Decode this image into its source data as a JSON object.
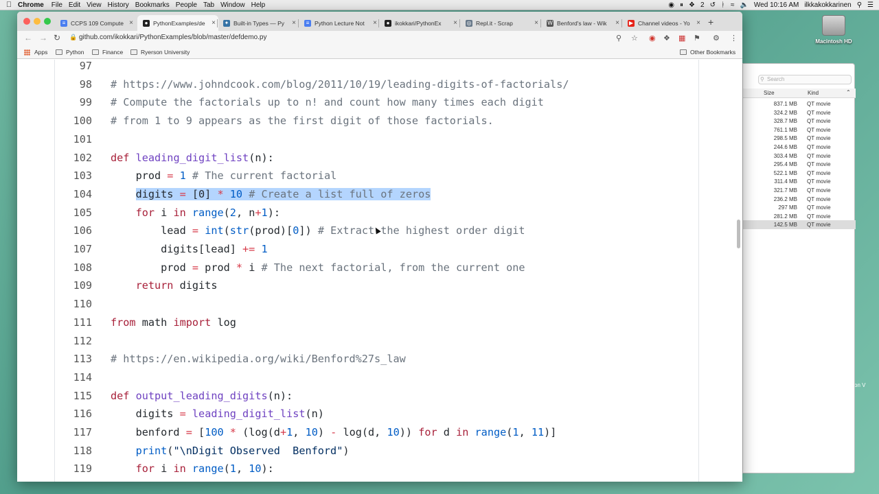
{
  "menubar": {
    "app": "Chrome",
    "items": [
      "File",
      "Edit",
      "View",
      "History",
      "Bookmarks",
      "People",
      "Tab",
      "Window",
      "Help"
    ],
    "status": {
      "badge": "2",
      "datetime": "Wed 10:16 AM",
      "user": "ilkkakokkarinen"
    }
  },
  "desktop": {
    "drive_label": "Macintosh HD",
    "fragment": "on V"
  },
  "finder": {
    "search_placeholder": "Search",
    "columns": {
      "size": "Size",
      "kind": "Kind"
    },
    "rows": [
      {
        "size": "837.1 MB",
        "kind": "QT movie"
      },
      {
        "size": "324.2 MB",
        "kind": "QT movie"
      },
      {
        "size": "328.7 MB",
        "kind": "QT movie"
      },
      {
        "size": "761.1 MB",
        "kind": "QT movie"
      },
      {
        "size": "298.5 MB",
        "kind": "QT movie"
      },
      {
        "size": "244.6 MB",
        "kind": "QT movie"
      },
      {
        "size": "303.4 MB",
        "kind": "QT movie"
      },
      {
        "size": "295.4 MB",
        "kind": "QT movie"
      },
      {
        "size": "522.1 MB",
        "kind": "QT movie"
      },
      {
        "size": "311.4 MB",
        "kind": "QT movie"
      },
      {
        "size": "321.7 MB",
        "kind": "QT movie"
      },
      {
        "size": "236.2 MB",
        "kind": "QT movie"
      },
      {
        "size": "297 MB",
        "kind": "QT movie"
      },
      {
        "size": "281.2 MB",
        "kind": "QT movie"
      },
      {
        "size": "142.5 MB",
        "kind": "QT movie"
      }
    ]
  },
  "browser": {
    "tabs": [
      {
        "title": "CCPS 109 Compute",
        "icon": "docs-icon",
        "color": "#4a7ef0"
      },
      {
        "title": "PythonExamples/de",
        "icon": "github-icon",
        "color": "#222222"
      },
      {
        "title": "Built-in Types — Py",
        "icon": "python-icon",
        "color": "#3572a5"
      },
      {
        "title": "Python Lecture Not",
        "icon": "docs-icon",
        "color": "#4a7ef0"
      },
      {
        "title": "ikokkari/PythonEx",
        "icon": "github-icon",
        "color": "#222222"
      },
      {
        "title": "Repl.it - Scrap",
        "icon": "replit-icon",
        "color": "#667788"
      },
      {
        "title": "Benford's law - Wik",
        "icon": "wikipedia-icon",
        "color": "#555555"
      },
      {
        "title": "Channel videos - Yo",
        "icon": "youtube-icon",
        "color": "#e62117"
      }
    ],
    "url": "github.com/ikokkari/PythonExamples/blob/master/defdemo.py",
    "bookmarks": [
      "Apps",
      "Python",
      "Finance",
      "Ryerson University"
    ],
    "other_bookmarks": "Other Bookmarks"
  },
  "code": {
    "lines": [
      {
        "n": "97",
        "t": []
      },
      {
        "n": "98",
        "t": [
          [
            "cm",
            "# https://www.johndcook.com/blog/2011/10/19/leading-digits-of-factorials/"
          ]
        ]
      },
      {
        "n": "99",
        "t": [
          [
            "cm",
            "# Compute the factorials up to n! and count how many times each digit"
          ]
        ]
      },
      {
        "n": "100",
        "t": [
          [
            "cm",
            "# from 1 to 9 appears as the first digit of those factorials."
          ]
        ]
      },
      {
        "n": "101",
        "t": []
      },
      {
        "n": "102",
        "t": [
          [
            "kw",
            "def"
          ],
          [
            "",
            " "
          ],
          [
            "fn",
            "leading_digit_list"
          ],
          [
            "",
            "(n):"
          ]
        ]
      },
      {
        "n": "103",
        "t": [
          [
            "",
            "    prod "
          ],
          [
            "op",
            "="
          ],
          [
            "",
            " "
          ],
          [
            "nu",
            "1"
          ],
          [
            "",
            " "
          ],
          [
            "cm",
            "# The current factorial"
          ]
        ]
      },
      {
        "n": "104",
        "hl": true,
        "t": [
          [
            "",
            "    "
          ],
          [
            "hl",
            "digits "
          ],
          [
            "hl op",
            "="
          ],
          [
            "hl",
            " [0] "
          ],
          [
            "hl op",
            "*"
          ],
          [
            "hl",
            " "
          ],
          [
            "hl nu",
            "10"
          ],
          [
            "hl",
            " "
          ],
          [
            "hl cm",
            "# Create a list full of zeros"
          ]
        ]
      },
      {
        "n": "105",
        "t": [
          [
            "",
            "    "
          ],
          [
            "kw",
            "for"
          ],
          [
            "",
            " i "
          ],
          [
            "kw",
            "in"
          ],
          [
            "",
            " "
          ],
          [
            "bi",
            "range"
          ],
          [
            "",
            "("
          ],
          [
            "nu",
            "2"
          ],
          [
            "",
            ", n"
          ],
          [
            "op",
            "+"
          ],
          [
            "nu",
            "1"
          ],
          [
            "",
            "):"
          ]
        ]
      },
      {
        "n": "106",
        "t": [
          [
            "",
            "        lead "
          ],
          [
            "op",
            "="
          ],
          [
            "",
            " "
          ],
          [
            "bi",
            "int"
          ],
          [
            "",
            "("
          ],
          [
            "bi",
            "str"
          ],
          [
            "",
            "(prod)["
          ],
          [
            "nu",
            "0"
          ],
          [
            "",
            "]) "
          ],
          [
            "cm",
            "# Extract the highest order digit"
          ]
        ]
      },
      {
        "n": "107",
        "t": [
          [
            "",
            "        digits[lead] "
          ],
          [
            "op",
            "+="
          ],
          [
            "",
            " "
          ],
          [
            "nu",
            "1"
          ]
        ]
      },
      {
        "n": "108",
        "t": [
          [
            "",
            "        prod "
          ],
          [
            "op",
            "="
          ],
          [
            "",
            " prod "
          ],
          [
            "op",
            "*"
          ],
          [
            "",
            " i "
          ],
          [
            "cm",
            "# The next factorial, from the current one"
          ]
        ]
      },
      {
        "n": "109",
        "t": [
          [
            "",
            "    "
          ],
          [
            "kw",
            "return"
          ],
          [
            "",
            " digits"
          ]
        ]
      },
      {
        "n": "110",
        "t": []
      },
      {
        "n": "111",
        "t": [
          [
            "kw",
            "from"
          ],
          [
            "",
            " math "
          ],
          [
            "kw",
            "import"
          ],
          [
            "",
            " log"
          ]
        ]
      },
      {
        "n": "112",
        "t": []
      },
      {
        "n": "113",
        "t": [
          [
            "cm",
            "# https://en.wikipedia.org/wiki/Benford%27s_law"
          ]
        ]
      },
      {
        "n": "114",
        "t": []
      },
      {
        "n": "115",
        "t": [
          [
            "kw",
            "def"
          ],
          [
            "",
            " "
          ],
          [
            "fn",
            "output_leading_digits"
          ],
          [
            "",
            "(n):"
          ]
        ]
      },
      {
        "n": "116",
        "t": [
          [
            "",
            "    digits "
          ],
          [
            "op",
            "="
          ],
          [
            "",
            " "
          ],
          [
            "fn",
            "leading_digit_list"
          ],
          [
            "",
            "(n)"
          ]
        ]
      },
      {
        "n": "117",
        "t": [
          [
            "",
            "    benford "
          ],
          [
            "op",
            "="
          ],
          [
            "",
            " ["
          ],
          [
            "nu",
            "100"
          ],
          [
            "",
            " "
          ],
          [
            "op",
            "*"
          ],
          [
            "",
            " (log(d"
          ],
          [
            "op",
            "+"
          ],
          [
            "nu",
            "1"
          ],
          [
            "",
            ", "
          ],
          [
            "nu",
            "10"
          ],
          [
            "",
            ") "
          ],
          [
            "op",
            "-"
          ],
          [
            "",
            " log(d, "
          ],
          [
            "nu",
            "10"
          ],
          [
            "",
            ")) "
          ],
          [
            "kw",
            "for"
          ],
          [
            "",
            " d "
          ],
          [
            "kw",
            "in"
          ],
          [
            "",
            " "
          ],
          [
            "bi",
            "range"
          ],
          [
            "",
            "("
          ],
          [
            "nu",
            "1"
          ],
          [
            "",
            ", "
          ],
          [
            "nu",
            "11"
          ],
          [
            "",
            ")]"
          ]
        ]
      },
      {
        "n": "118",
        "t": [
          [
            "",
            "    "
          ],
          [
            "bi",
            "print"
          ],
          [
            "",
            "("
          ],
          [
            "st",
            "\"\\nDigit Observed  Benford\""
          ],
          [
            "",
            ")"
          ]
        ]
      },
      {
        "n": "119",
        "t": [
          [
            "",
            "    "
          ],
          [
            "kw",
            "for"
          ],
          [
            "",
            " i "
          ],
          [
            "kw",
            "in"
          ],
          [
            "",
            " "
          ],
          [
            "bi",
            "range"
          ],
          [
            "",
            "("
          ],
          [
            "nu",
            "1"
          ],
          [
            "",
            ", "
          ],
          [
            "nu",
            "10"
          ],
          [
            "",
            "):"
          ]
        ]
      }
    ]
  }
}
